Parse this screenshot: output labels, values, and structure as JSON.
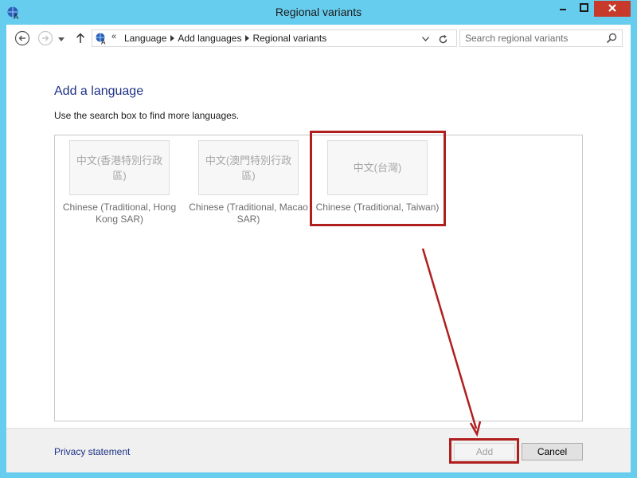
{
  "window": {
    "title": "Regional variants"
  },
  "navbar": {
    "back_icon": "back-arrow-icon",
    "forward_icon": "forward-arrow-icon",
    "recent_icon": "chevron-down-icon",
    "up_icon": "up-arrow-icon",
    "breadcrumb_overflow": "«",
    "breadcrumbs": [
      "Language",
      "Add languages",
      "Regional variants"
    ],
    "search_placeholder": "Search regional variants"
  },
  "main": {
    "heading": "Add a language",
    "instructions": "Use the search box to find more languages.",
    "languages": [
      {
        "native": "中文(香港特別行政區)",
        "label": "Chinese (Traditional, Hong Kong SAR)"
      },
      {
        "native": "中文(澳門特別行政區)",
        "label": "Chinese (Traditional, Macao SAR)"
      },
      {
        "native": "中文(台灣)",
        "label": "Chinese (Traditional, Taiwan)"
      }
    ]
  },
  "footer": {
    "privacy_link": "Privacy statement",
    "add_label": "Add",
    "cancel_label": "Cancel"
  },
  "colors": {
    "titlebar": "#67cdee",
    "close_button": "#c7392b",
    "heading_blue": "#1e3287",
    "annotation_red": "#b01e1e"
  }
}
